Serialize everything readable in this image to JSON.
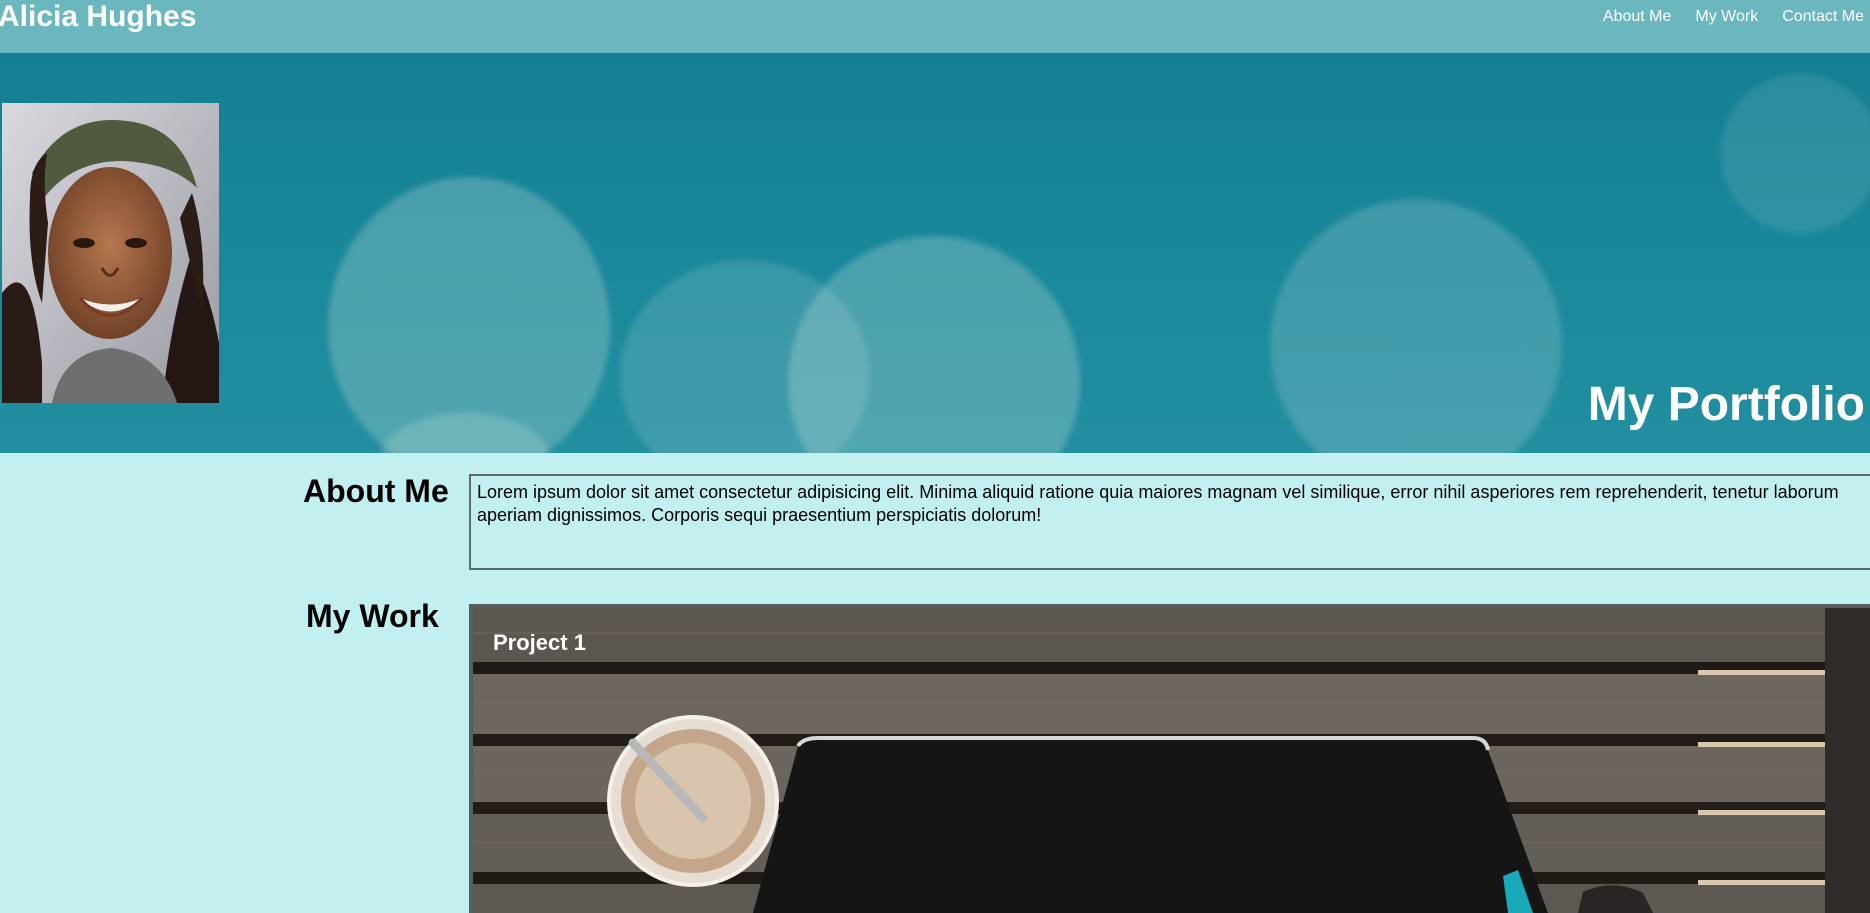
{
  "navbar": {
    "brand": "Alicia Hughes",
    "links": [
      "About Me",
      "My Work",
      "Contact Me"
    ]
  },
  "hero": {
    "title": "My Portfolio",
    "portrait_alt": "Portrait photo of Alicia Hughes"
  },
  "about": {
    "heading": "About Me",
    "text": "Lorem ipsum dolor sit amet consectetur adipisicing elit. Minima aliquid ratione quia maiores magnam vel similique, error nihil asperiores rem reprehenderit, tenetur laborum aperiam dignissimos. Corporis sequi praesentium perspiciatis dolorum!"
  },
  "work": {
    "heading": "My Work",
    "projects": [
      {
        "title": "Project 1"
      }
    ]
  },
  "colors": {
    "navbar": "#6bb7be",
    "hero": "#1a899c",
    "page_background": "#c2f0f0",
    "box_border": "#5b6b6b",
    "text_light": "#ffffff",
    "text_dark": "#000000"
  }
}
